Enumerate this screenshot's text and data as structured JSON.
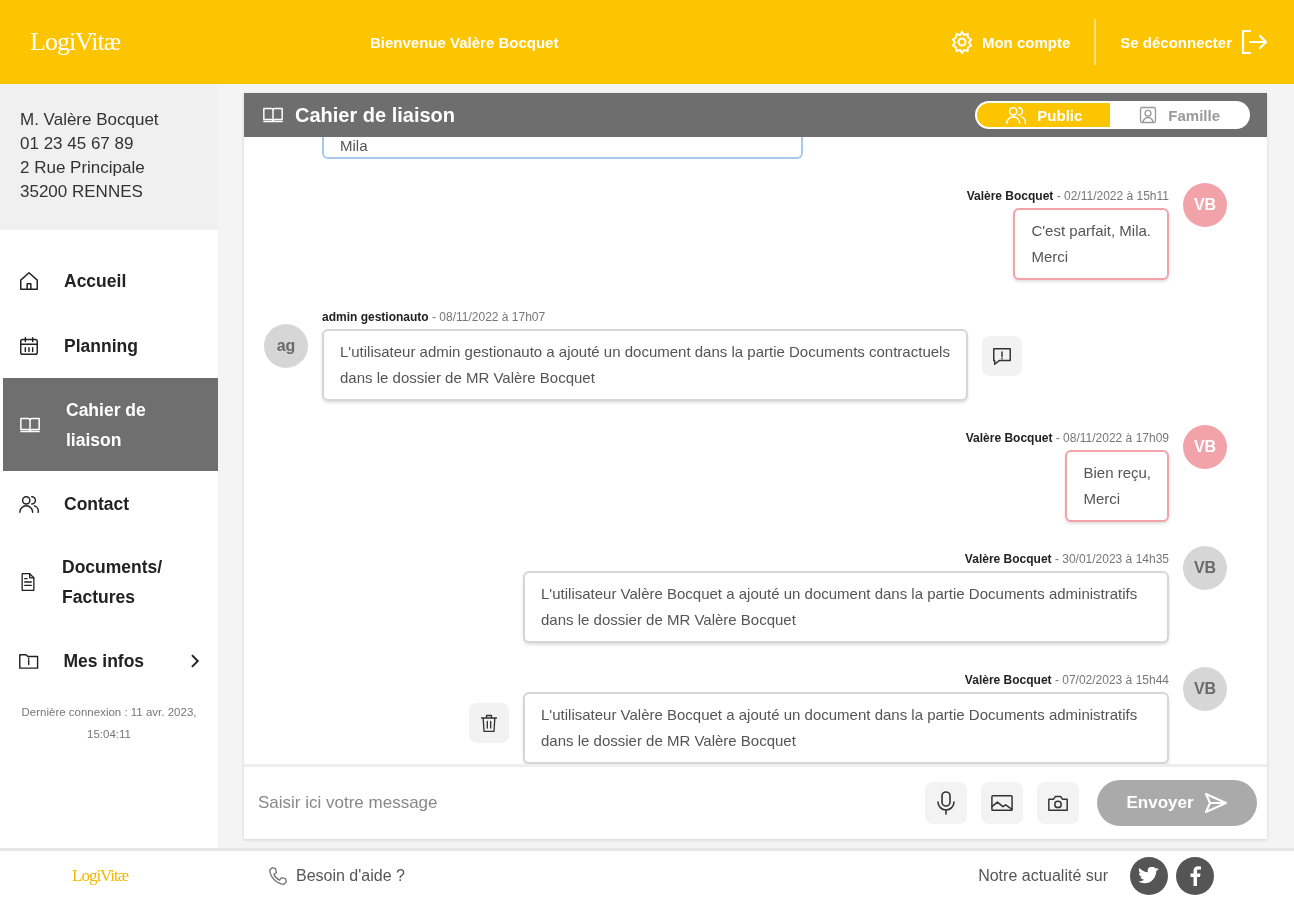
{
  "header": {
    "logo": "LogiVitæ",
    "welcome": "Bienvenue Valère Bocquet",
    "account": "Mon compte",
    "logout": "Se déconnecter"
  },
  "sidebar": {
    "address": [
      "M. Valère Bocquet",
      "01 23 45 67 89",
      "2 Rue Principale",
      "35200 RENNES"
    ],
    "items": [
      {
        "label": "Accueil",
        "selected": false,
        "submenu": false
      },
      {
        "label": "Planning",
        "selected": false,
        "submenu": false
      },
      {
        "label": "Cahier de liaison",
        "selected": true,
        "submenu": false
      },
      {
        "label": "Contact",
        "selected": false,
        "submenu": false
      },
      {
        "label": "Documents/ Factures",
        "selected": false,
        "submenu": false
      },
      {
        "label": "Mes infos",
        "selected": false,
        "submenu": true
      }
    ],
    "last_login": "Dernière connexion : 11 avr. 2023, 15:04:11"
  },
  "panel": {
    "title": "Cahier de liaison",
    "tabs": [
      {
        "label": "Public",
        "selected": true
      },
      {
        "label": "Famille",
        "selected": false
      }
    ],
    "messages": [
      {
        "kind": "clipped",
        "color": "#a9c8ec",
        "text": "Mila"
      },
      {
        "kind": "outgoing",
        "color": "#f2a2a9",
        "avatar": "VB",
        "meta": "**Valère Bocquet** - 02/11/2022 à 15h11",
        "text": "C'est parfait, Mila.\nMerci",
        "reportable": false,
        "deletable": false
      },
      {
        "kind": "incoming",
        "color": "#d6d6d6",
        "avatar": "ag",
        "meta": "**admin gestionauto** - 08/11/2022 à 17h07",
        "text": "L'utilisateur admin gestionauto a ajouté un document dans la partie Documents contractuels dans le dossier de MR Valère Bocquet",
        "reportable": true,
        "deletable": false
      },
      {
        "kind": "outgoing",
        "color": "#f2a2a9",
        "avatar": "VB",
        "meta": "**Valère Bocquet** - 08/11/2022 à 17h09",
        "text": "Bien reçu,\nMerci",
        "reportable": false,
        "deletable": false
      },
      {
        "kind": "outgoing",
        "color": "#d6d6d6",
        "avatar": "VB",
        "meta": "**Valère Bocquet** - 30/01/2023 à 14h35",
        "text": "L'utilisateur Valère Bocquet a ajouté un document dans la partie Documents administratifs dans le dossier de MR Valère Bocquet",
        "reportable": false,
        "deletable": false
      },
      {
        "kind": "outgoing",
        "color": "#d6d6d6",
        "avatar": "VB",
        "meta": "**Valère Bocquet** - 07/02/2023 à 15h44",
        "text": "L'utilisateur Valère Bocquet a ajouté un document dans la partie Documents administratifs dans le dossier de MR Valère Bocquet",
        "reportable": false,
        "deletable": true
      }
    ],
    "composer": {
      "placeholder": "Saisir ici votre message",
      "send": "Envoyer"
    }
  },
  "footer": {
    "logo": "LogiVitæ",
    "help": "Besoin d'aide ?",
    "social": "Notre actualité sur"
  }
}
